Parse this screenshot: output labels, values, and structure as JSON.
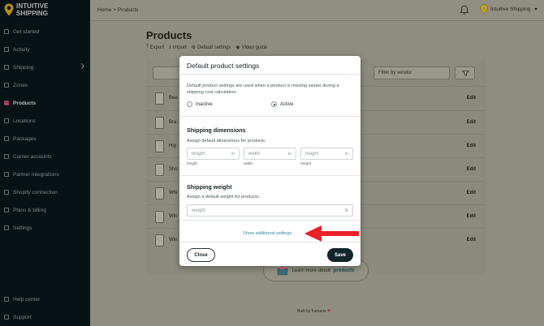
{
  "brand": {
    "line1": "INTUITIVE",
    "line2": "SHIPPING",
    "accent": "#f5c518"
  },
  "sidebar": {
    "items": [
      {
        "label": "Get started",
        "icon": "lightning-icon"
      },
      {
        "label": "Activity",
        "icon": "activity-icon"
      },
      {
        "label": "Shipping",
        "icon": "shipping-icon"
      },
      {
        "label": "Zones",
        "icon": "zones-icon"
      },
      {
        "label": "Products",
        "icon": "products-icon",
        "active": true
      },
      {
        "label": "Locations",
        "icon": "location-icon"
      },
      {
        "label": "Packages",
        "icon": "package-icon"
      },
      {
        "label": "Carrier accounts",
        "icon": "carrier-icon"
      },
      {
        "label": "Partner integrations",
        "icon": "integrations-icon"
      },
      {
        "label": "Shopify connection",
        "icon": "shopify-icon"
      },
      {
        "label": "Plans & billing",
        "icon": "billing-icon"
      },
      {
        "label": "Settings",
        "icon": "gear-icon"
      }
    ],
    "bottom": [
      {
        "label": "Help center",
        "icon": "help-icon"
      },
      {
        "label": "Support",
        "icon": "support-icon"
      }
    ]
  },
  "topbar": {
    "breadcrumb": "Home > Products",
    "user": "Intuitive Shipping"
  },
  "page": {
    "title": "Products",
    "actions": [
      "Export",
      "Import",
      "Default settings",
      "Video guide"
    ],
    "filter_vendor": "Filter by vendor",
    "rows": [
      {
        "name": "Bee",
        "edit": "Edit"
      },
      {
        "name": "Bra",
        "edit": "Edit"
      },
      {
        "name": "Hig",
        "edit": "Edit"
      },
      {
        "name": "Sho",
        "edit": "Edit"
      },
      {
        "name": "Whi",
        "edit": "Edit"
      },
      {
        "name": "Win",
        "edit": "Edit"
      },
      {
        "name": "Win",
        "edit": "Edit"
      }
    ],
    "learn_more": "Learn more about",
    "learn_more_bold": "products",
    "footer": "Built by humans"
  },
  "modal": {
    "title": "Default product settings",
    "description": "Default product settings are used when a product is missing values during a shipping cost calculation.",
    "status": {
      "inactive": "Inactive",
      "active": "Active",
      "selected": "Active"
    },
    "dimensions": {
      "title": "Shipping dimensions",
      "description": "Assign default dimensions for products.",
      "fields": [
        {
          "placeholder": "length",
          "unit": "in",
          "label": "length"
        },
        {
          "placeholder": "width",
          "unit": "in",
          "label": "width"
        },
        {
          "placeholder": "height",
          "unit": "in",
          "label": "height"
        }
      ]
    },
    "weight": {
      "title": "Shipping weight",
      "description": "Assign a default weight for products.",
      "placeholder": "weight",
      "unit": "lb"
    },
    "show_more": "Show additional settings",
    "close_label": "Close",
    "save_label": "Save"
  },
  "colors": {
    "annotation_arrow": "#e8202a",
    "link": "#2c8a99",
    "primary_button": "#10262b"
  }
}
